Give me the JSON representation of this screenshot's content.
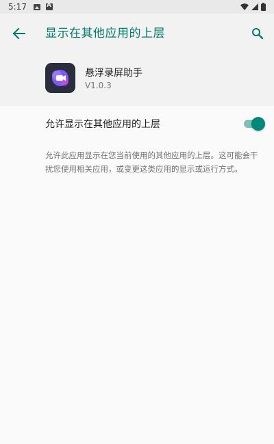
{
  "status_bar": {
    "time": "5:17",
    "icons": [
      "image-notification-icon",
      "a-notification-icon",
      "wifi-icon",
      "signal-icon",
      "battery-icon"
    ]
  },
  "app_bar": {
    "title": "显示在其他应用的上层",
    "back_icon": "arrow-left-icon",
    "search_icon": "search-icon",
    "accent_color": "#00796b"
  },
  "app_info": {
    "name": "悬浮录屏助手",
    "version": "V1.0.3",
    "icon": "screen-recorder-app-icon"
  },
  "setting": {
    "label": "允许显示在其他应用的上层",
    "enabled": true,
    "toggle_color": "#00897b"
  },
  "description": "允许此应用显示在您当前使用的其他应用的上层。这可能会干扰您使用相关应用，或变更这类应用的显示或运行方式。"
}
